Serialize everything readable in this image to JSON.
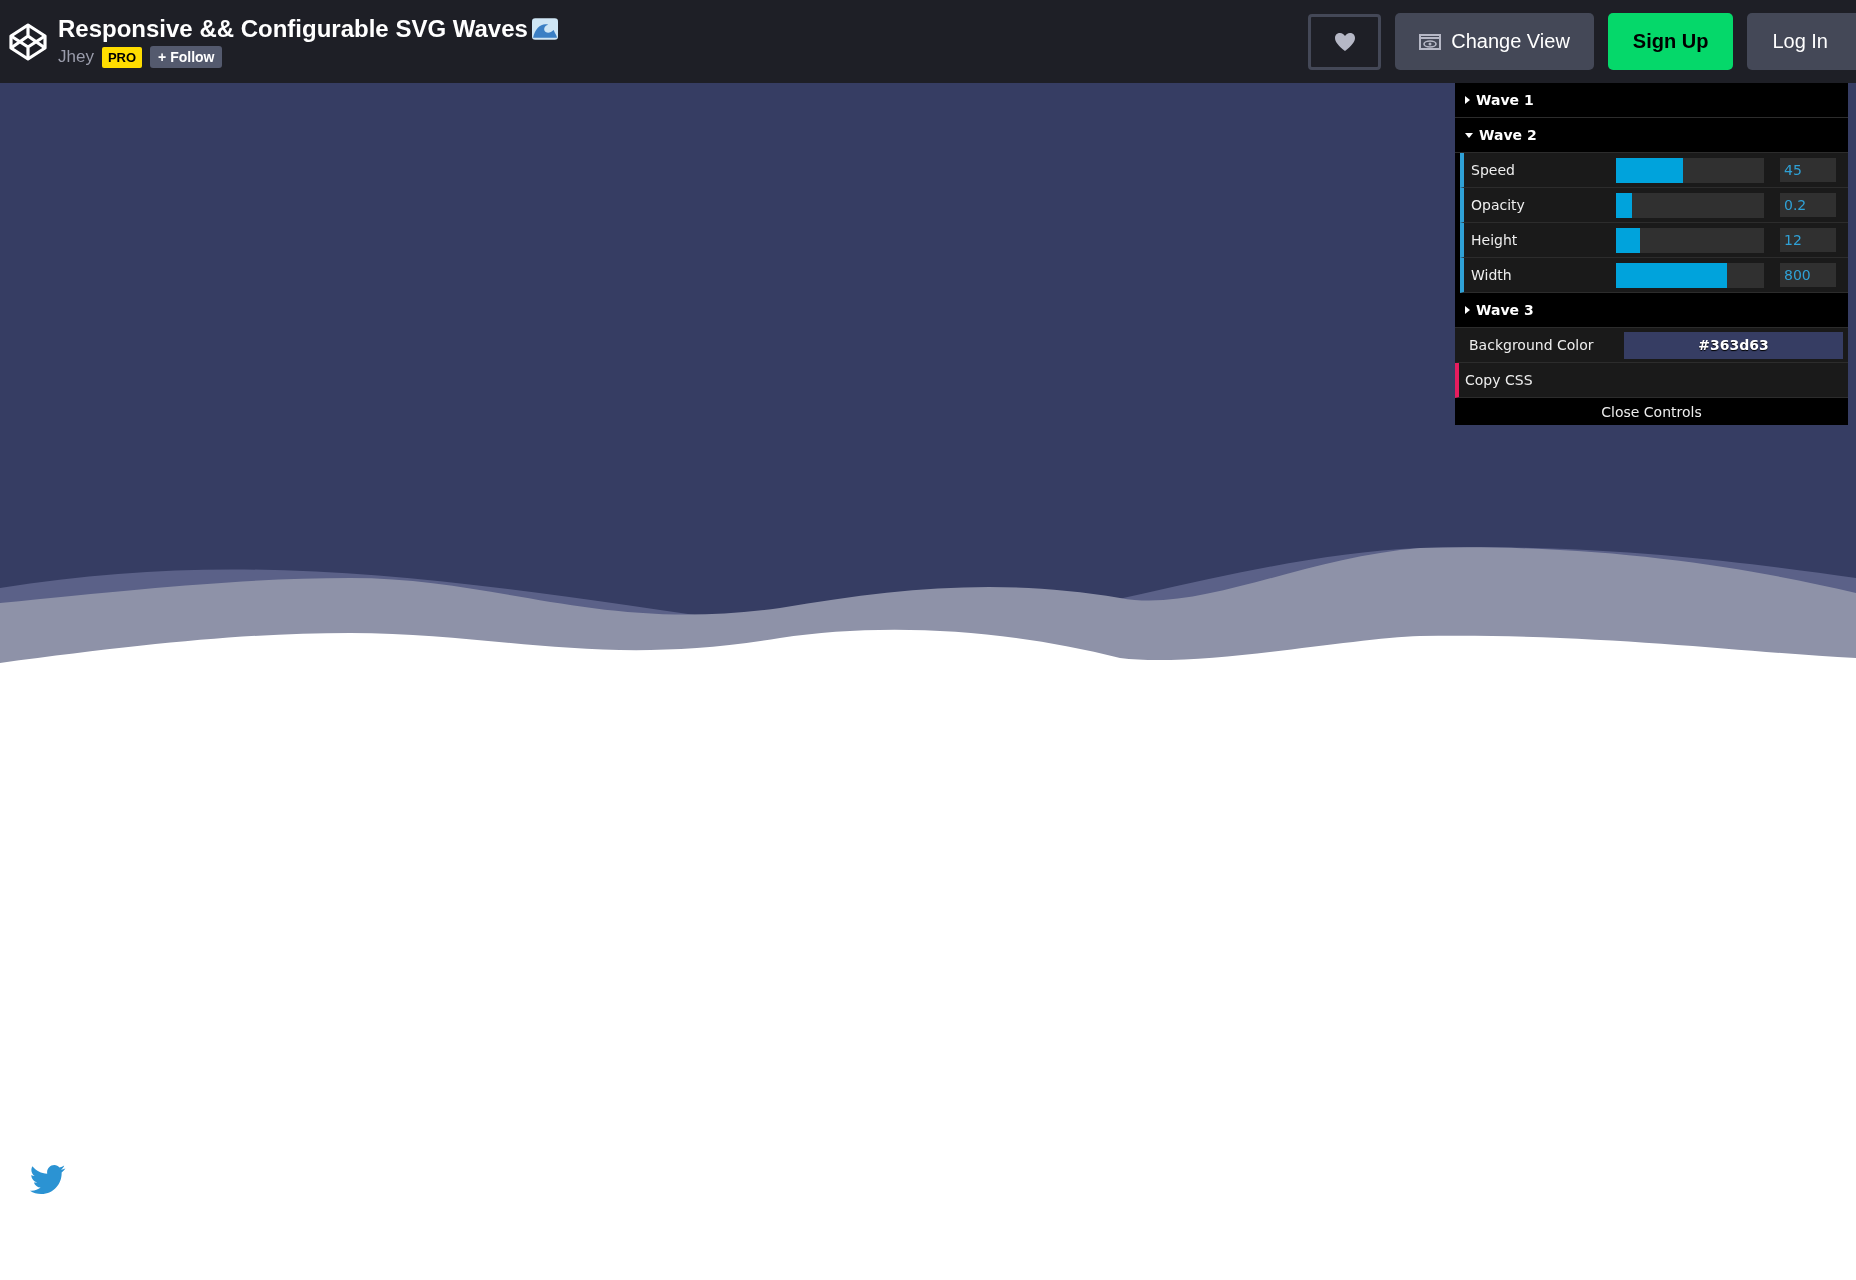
{
  "header": {
    "title": "Responsive && Configurable SVG Waves",
    "author": "Jhey",
    "badge": "PRO",
    "follow": "+ Follow",
    "buttons": [
      {
        "kind": "heart"
      },
      {
        "kind": "view",
        "label": "Change View"
      },
      {
        "kind": "signup",
        "label": "Sign Up"
      },
      {
        "kind": "login",
        "label": "Log In"
      }
    ]
  },
  "controls": {
    "folders": [
      {
        "name": "Wave 1",
        "expanded": false
      },
      {
        "name": "Wave 2",
        "expanded": true,
        "sliders": [
          {
            "label": "Speed",
            "level": 0.45,
            "value": "45"
          },
          {
            "label": "Opacity",
            "level": 0.11,
            "value": "0.2"
          },
          {
            "label": "Height",
            "level": 0.16,
            "value": "12"
          },
          {
            "label": "Width",
            "level": 0.75,
            "value": "800"
          }
        ]
      },
      {
        "name": "Wave 3",
        "expanded": false
      }
    ],
    "background": {
      "label": "Background Color",
      "value": "#363d63"
    },
    "copy": "Copy CSS",
    "close": "Close Controls"
  }
}
